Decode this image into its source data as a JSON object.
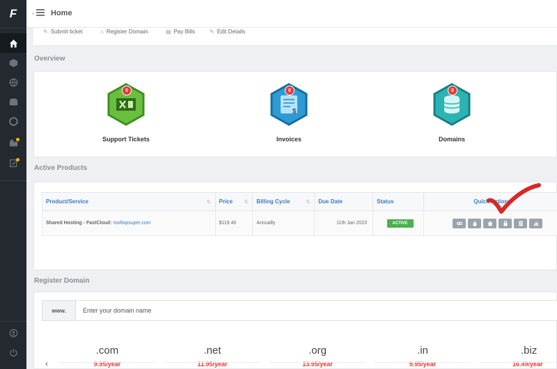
{
  "app": {
    "logo_letter": "F"
  },
  "sidebar": {
    "items": [
      {
        "icon": "home-icon",
        "active": true
      },
      {
        "icon": "cube-icon",
        "active": false
      },
      {
        "icon": "globe-icon",
        "active": false
      },
      {
        "icon": "wallet-icon",
        "active": false
      },
      {
        "icon": "lifebuoy-icon",
        "active": false
      },
      {
        "icon": "chart-icon",
        "active": false,
        "dot": true
      },
      {
        "icon": "task-icon",
        "active": false,
        "dot": true
      }
    ],
    "bottom": [
      {
        "icon": "user-icon"
      },
      {
        "icon": "power-icon"
      }
    ]
  },
  "header": {
    "title": "Home"
  },
  "quick_links": [
    {
      "label": "Submit ticket",
      "icon": "ticket-icon"
    },
    {
      "label": "Register Domain",
      "icon": "home-icon"
    },
    {
      "label": "Pay Bills",
      "icon": "bill-icon"
    },
    {
      "label": "Edit Details",
      "icon": "pencil-icon"
    }
  ],
  "overview": {
    "title": "Overview",
    "items": [
      {
        "label": "Support Tickets",
        "count": "0",
        "color": "#6abf3f",
        "border": "#3f8e22"
      },
      {
        "label": "Invoices",
        "count": "0",
        "color": "#2d9bd6",
        "border": "#1a6c9e"
      },
      {
        "label": "Domains",
        "count": "0",
        "color": "#2cb3b4",
        "border": "#1a7f80"
      }
    ]
  },
  "products": {
    "title": "Active Products",
    "columns": [
      "Product/Service",
      "Price",
      "Billing Cycle",
      "Due Date",
      "Status",
      "Quick Actions"
    ],
    "rows": [
      {
        "product": "Shared Hosting - FastCloud:",
        "domain": "rooftopsuper.com",
        "price": "$119.40",
        "cycle": "Annually",
        "due": "11th Jan 2023",
        "status": "ACTIVE"
      }
    ]
  },
  "register_domain": {
    "title": "Register Domain",
    "prefix": "www.",
    "placeholder": "Enter your domain name",
    "tlds": [
      {
        "name": ".com",
        "price": "9.95/year"
      },
      {
        "name": ".net",
        "price": "11.95/year"
      },
      {
        "name": ".org",
        "price": "13.95/year"
      },
      {
        "name": ".in",
        "price": "9.95/year"
      },
      {
        "name": ".biz",
        "price": "16.49/year"
      }
    ]
  },
  "colors": {
    "accent": "#3a7bc4",
    "sidebar": "#23292f",
    "danger": "#e53935",
    "success": "#4caf50"
  }
}
